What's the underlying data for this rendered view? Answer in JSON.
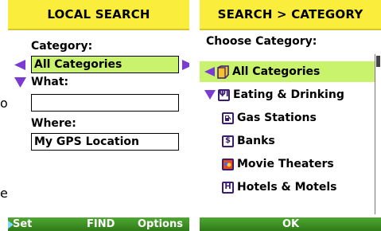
{
  "side_fragments": {
    "left_o": "o",
    "left_e": "e"
  },
  "left_screen": {
    "title": "LOCAL SEARCH",
    "category_label": "Category:",
    "category_value": "All Categories",
    "what_label": "What:",
    "what_value": "",
    "where_label": "Where:",
    "where_value": "My GPS Location",
    "softkeys": {
      "left": "Set",
      "center": "FIND",
      "right": "Options"
    }
  },
  "right_screen": {
    "title": "SEARCH > CATEGORY",
    "subtitle": "Choose Category:",
    "items": [
      {
        "label": "All Categories",
        "icon": "folder-icon",
        "selected": true
      },
      {
        "label": "Eating & Drinking",
        "icon": "utensils-icon",
        "expanded": true
      },
      {
        "label": "Gas Stations",
        "icon": "gas-pump-icon"
      },
      {
        "label": "Banks",
        "icon": "dollar-icon"
      },
      {
        "label": "Movie Theaters",
        "icon": "theater-masks-icon"
      },
      {
        "label": "Hotels & Motels",
        "icon": "hotel-icon"
      }
    ],
    "softkeys": {
      "center": "OK"
    }
  },
  "colors": {
    "title_bar": "#fbed3c",
    "softkey_bar": "#3a8f22",
    "selection": "#c9f36d",
    "arrow": "#7b3ad1"
  }
}
